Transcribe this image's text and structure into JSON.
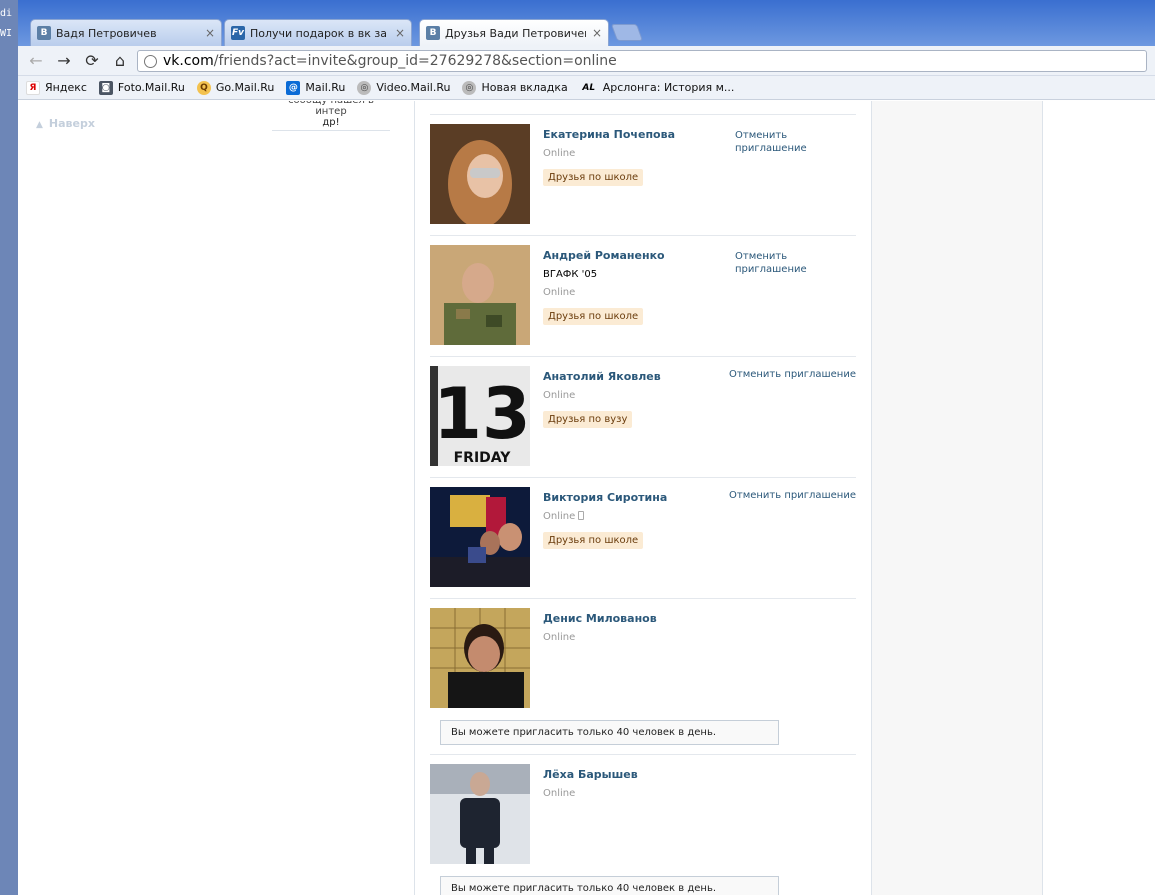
{
  "desktop": {
    "fragment_1": "WI",
    "fragment_2": "di"
  },
  "tabs": [
    {
      "icon": "В",
      "title": "Вадя Петровичев",
      "close": "×"
    },
    {
      "icon": "Fv",
      "title": "Получи подарок в вк за приг",
      "close": "×"
    },
    {
      "icon": "В",
      "title": "Друзья Вади Петровичева |",
      "close": "×"
    }
  ],
  "toolbar": {
    "back": "←",
    "forward": "→",
    "reload": "⟳",
    "home": "⌂",
    "url_host": "vk.com",
    "url_rest": "/friends?act=invite&group_id=27629278&section=online"
  },
  "bookmarks": [
    {
      "icon": "Я",
      "label": "Яндекс"
    },
    {
      "icon": "◙",
      "label": "Foto.Mail.Ru"
    },
    {
      "icon": "Q",
      "label": "Go.Mail.Ru"
    },
    {
      "icon": "@",
      "label": "Mail.Ru"
    },
    {
      "icon": "◎",
      "label": "Video.Mail.Ru"
    },
    {
      "icon": "◎",
      "label": "Новая вкладка"
    },
    {
      "icon": "AL",
      "label": "Арслонга: История м..."
    }
  ],
  "sidebar": {
    "up_link": "Наверх",
    "snippet_cut": "сообщу нашел в интер",
    "snippet_end": "др!"
  },
  "friends": [
    {
      "name": "Екатерина Почепова",
      "status": "Online",
      "tag": "Друзья по школе",
      "action": "Отменить приглашение"
    },
    {
      "name": "Андрей Романенко",
      "university": "ВГАФК '05",
      "status": "Online",
      "tag": "Друзья по школе",
      "action": "Отменить приглашение"
    },
    {
      "name": "Анатолий Яковлев",
      "status": "Online",
      "tag": "Друзья по вузу",
      "action": "Отменить приглашение",
      "photo_text_1": "13",
      "photo_text_2": "FRIDAY"
    },
    {
      "name": "Виктория Сиротина",
      "status": "Online",
      "tag": "Друзья по школе",
      "action": "Отменить приглашение"
    },
    {
      "name": "Денис Милованов",
      "status": "Online",
      "notice": "Вы можете пригласить только 40 человек в день."
    },
    {
      "name": "Лёха Барышев",
      "status": "Online",
      "notice": "Вы можете пригласить только 40 человек в день."
    }
  ],
  "colors": {
    "link": "#2b587a",
    "tag_bg": "#fbebd4",
    "online": "#999999"
  }
}
